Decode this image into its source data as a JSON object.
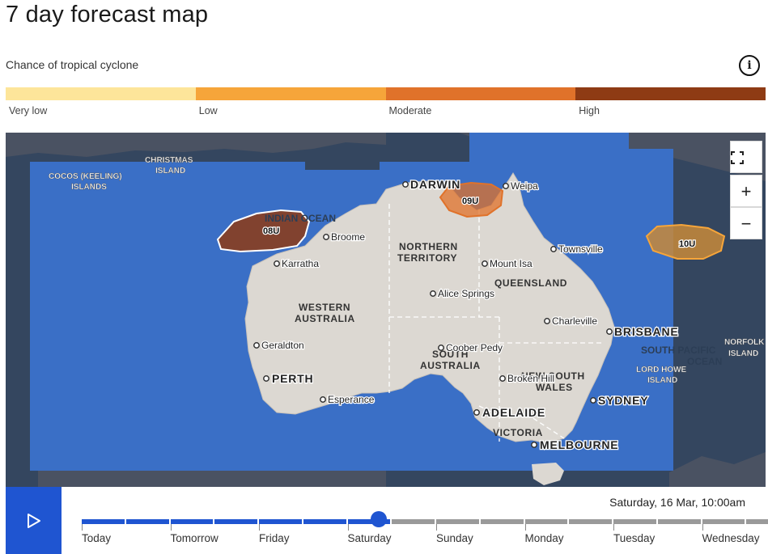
{
  "page": {
    "title": "7 day forecast map"
  },
  "legend": {
    "title": "Chance of tropical cyclone",
    "info_icon": "info-icon",
    "levels": [
      {
        "label": "Very low",
        "color": "#fde59a"
      },
      {
        "label": "Low",
        "color": "#f6a53a"
      },
      {
        "label": "Moderate",
        "color": "#e0722a"
      },
      {
        "label": "High",
        "color": "#8e3b14"
      }
    ]
  },
  "map": {
    "controls": {
      "fullscreen_icon": "fullscreen-icon",
      "zoom_in": "+",
      "zoom_out": "−"
    },
    "ocean_labels": {
      "indian_ocean": "INDIAN OCEAN",
      "south_pacific_1": "SOUTH PACIFIC",
      "south_pacific_2": "OCEAN"
    },
    "islands": {
      "christmas_1": "CHRISTMAS",
      "christmas_2": "ISLAND",
      "cocos_1": "COCOS (KEELING)",
      "cocos_2": "ISLANDS",
      "lordhowe_1": "LORD HOWE",
      "lordhowe_2": "ISLAND",
      "norfolk_1": "NORFOLK",
      "norfolk_2": "ISLAND"
    },
    "regions": {
      "nt_1": "NORTHERN",
      "nt_2": "TERRITORY",
      "wa_1": "WESTERN",
      "wa_2": "AUSTRALIA",
      "sa_1": "SOUTH",
      "sa_2": "AUSTRALIA",
      "qld": "QUEENSLAND",
      "nsw_1": "NEW SOUTH",
      "nsw_2": "WALES",
      "vic": "VICTORIA"
    },
    "cities": {
      "darwin": "DARWIN",
      "weipa": "Weipa",
      "broome": "Broome",
      "karratha": "Karratha",
      "townsville": "Townsville",
      "mount_isa": "Mount Isa",
      "alice_springs": "Alice Springs",
      "charleville": "Charleville",
      "brisbane": "BRISBANE",
      "geraldton": "Geraldton",
      "coober_pedy": "Coober Pedy",
      "broken_hill": "Broken Hill",
      "perth": "PERTH",
      "esperance": "Esperance",
      "sydney": "SYDNEY",
      "adelaide": "ADELAIDE",
      "melbourne": "MELBOURNE"
    },
    "systems": [
      {
        "id": "08U",
        "chance": "High",
        "color": "#8e3b14"
      },
      {
        "id": "09U",
        "chance": "Moderate",
        "color": "#e0722a"
      },
      {
        "id": "10U",
        "chance": "Low",
        "color": "#f6a53a"
      }
    ]
  },
  "timeline": {
    "play_icon": "play-icon",
    "current_time": "Saturday, 16 Mar, 10:00am",
    "days": [
      "Today",
      "Tomorrow",
      "Friday",
      "Saturday",
      "Sunday",
      "Monday",
      "Tuesday",
      "Wednesday"
    ],
    "progress_fraction": 0.42,
    "colors": {
      "active": "#1f55d1",
      "inactive": "#9a9a9a"
    }
  }
}
